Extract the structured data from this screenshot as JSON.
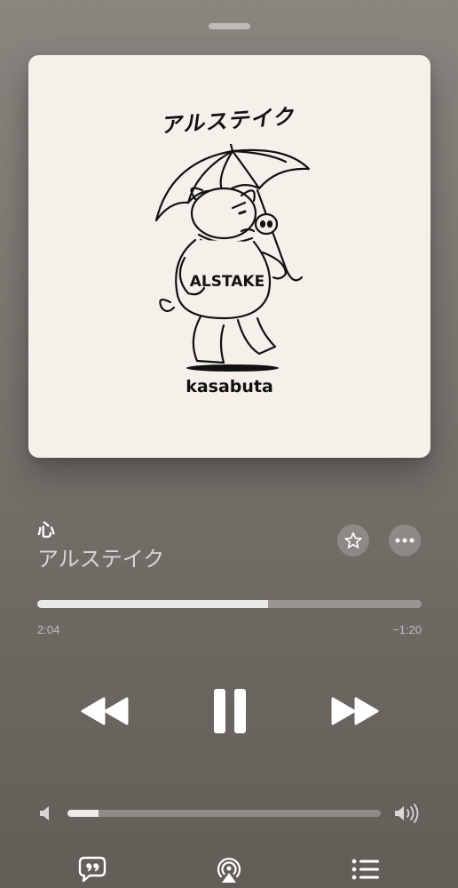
{
  "artwork": {
    "title_jp": "アルステイク",
    "sweater_text": "ALSTAKE",
    "caption": "kasabuta"
  },
  "now_playing": {
    "title": "心",
    "artist": "アルステイク"
  },
  "playback": {
    "elapsed": "2:04",
    "remaining": "−1:20",
    "progress_fraction": 0.6
  },
  "volume": {
    "level_fraction": 0.1
  },
  "controls": {
    "rewind_icon": "rewind-icon",
    "pause_icon": "pause-icon",
    "forward_icon": "fast-forward-icon",
    "star_icon": "star-icon",
    "more_icon": "ellipsis-icon",
    "lyrics_icon": "lyrics-icon",
    "airplay_icon": "airplay-icon",
    "queue_icon": "queue-list-icon"
  }
}
